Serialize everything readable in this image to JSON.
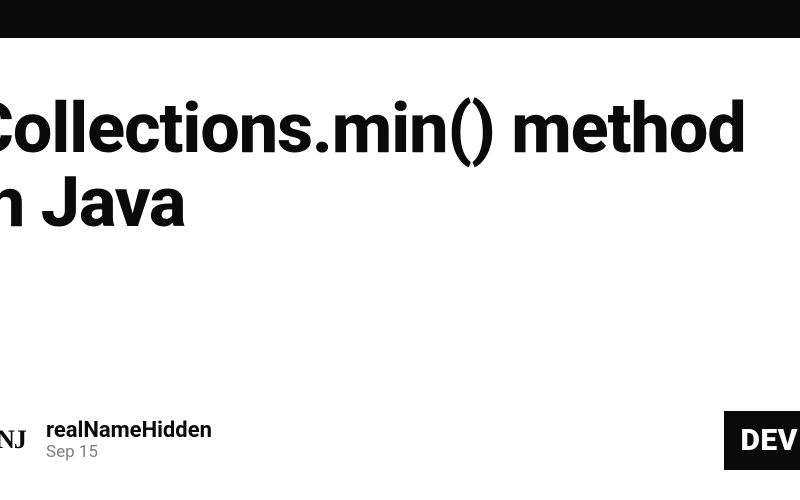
{
  "article": {
    "title": "Collections.min() method in Java"
  },
  "author": {
    "avatar_initials": "NJ",
    "name": "realNameHidden",
    "date": "Sep 15"
  },
  "badge": {
    "label": "DEV"
  }
}
